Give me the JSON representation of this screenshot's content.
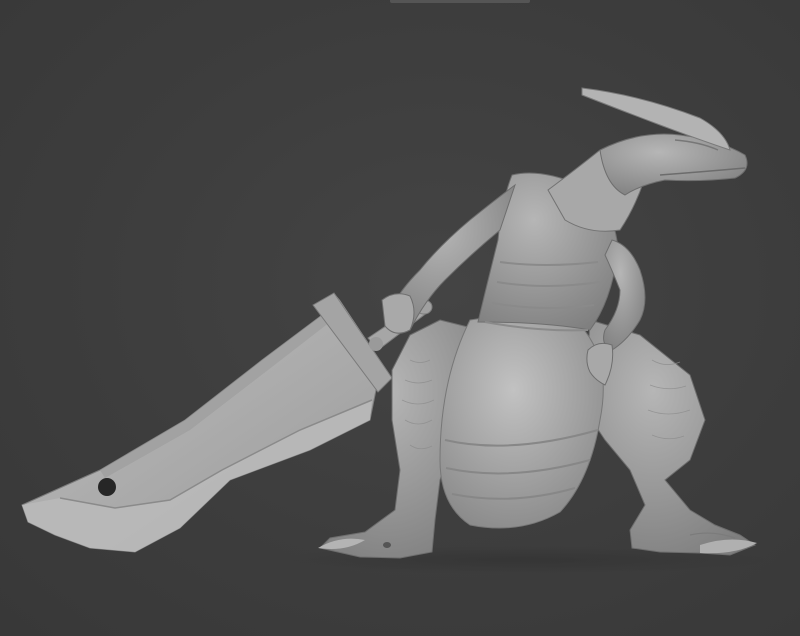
{
  "viewport": {
    "background_color": "#3d3d3d",
    "model_color": "#a9a9a9",
    "subject": "3d-sculpt-creature-with-cleaver"
  }
}
